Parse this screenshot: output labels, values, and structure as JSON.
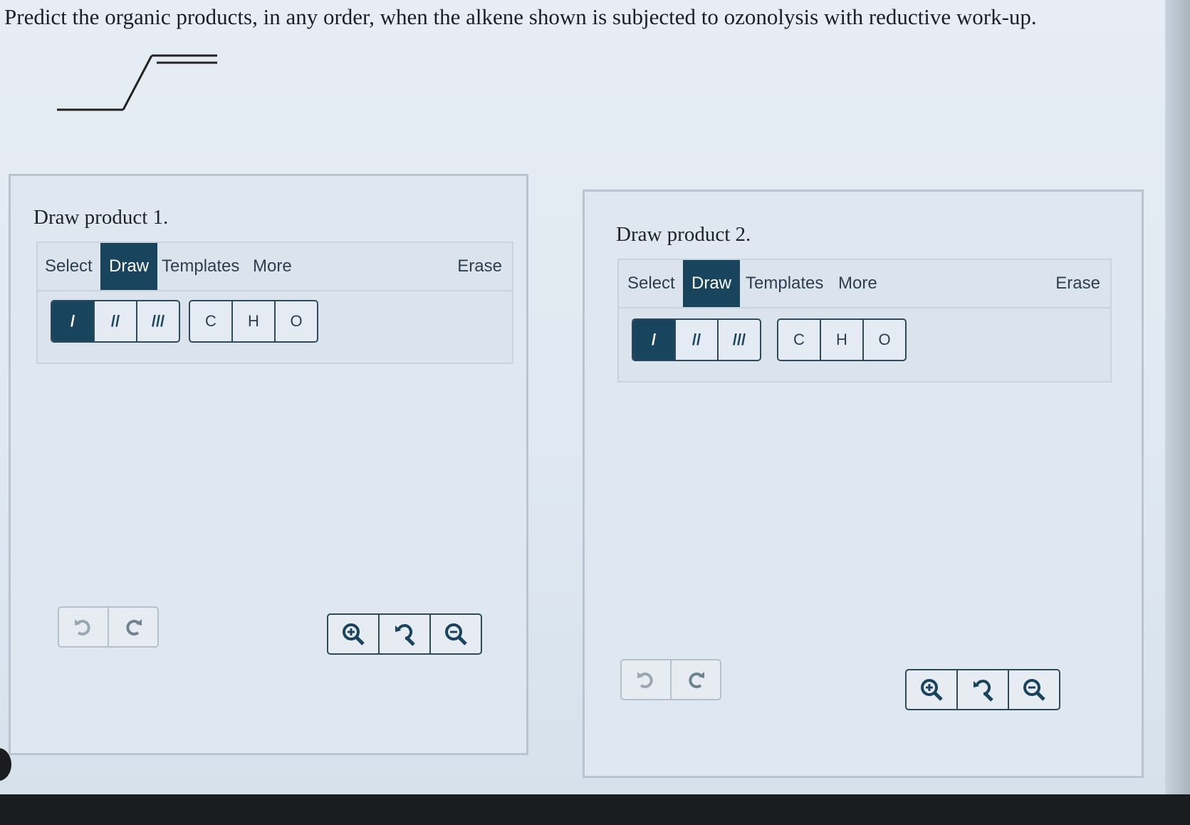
{
  "question": "Predict the organic products, in any order, when the alkene shown is subjected to ozonolysis with reductive work-up.",
  "panels": [
    {
      "title": "Draw product 1.",
      "tabs": {
        "select": "Select",
        "draw": "Draw",
        "templates": "Templates",
        "more": "More",
        "erase": "Erase"
      },
      "bonds": [
        "/",
        "//",
        "///"
      ],
      "atoms": [
        "C",
        "H",
        "O"
      ]
    },
    {
      "title": "Draw product 2.",
      "tabs": {
        "select": "Select",
        "draw": "Draw",
        "templates": "Templates",
        "more": "More",
        "erase": "Erase"
      },
      "bonds": [
        "/",
        "//",
        "///"
      ],
      "atoms": [
        "C",
        "H",
        "O"
      ]
    }
  ],
  "colors": {
    "accent": "#19445d",
    "text": "#1e2227",
    "muted_border": "#b8c4cf"
  },
  "icons": [
    "single-bond-icon",
    "double-bond-icon",
    "triple-bond-icon",
    "undo-icon",
    "redo-icon",
    "zoom-in-icon",
    "zoom-reset-icon",
    "zoom-out-icon"
  ]
}
